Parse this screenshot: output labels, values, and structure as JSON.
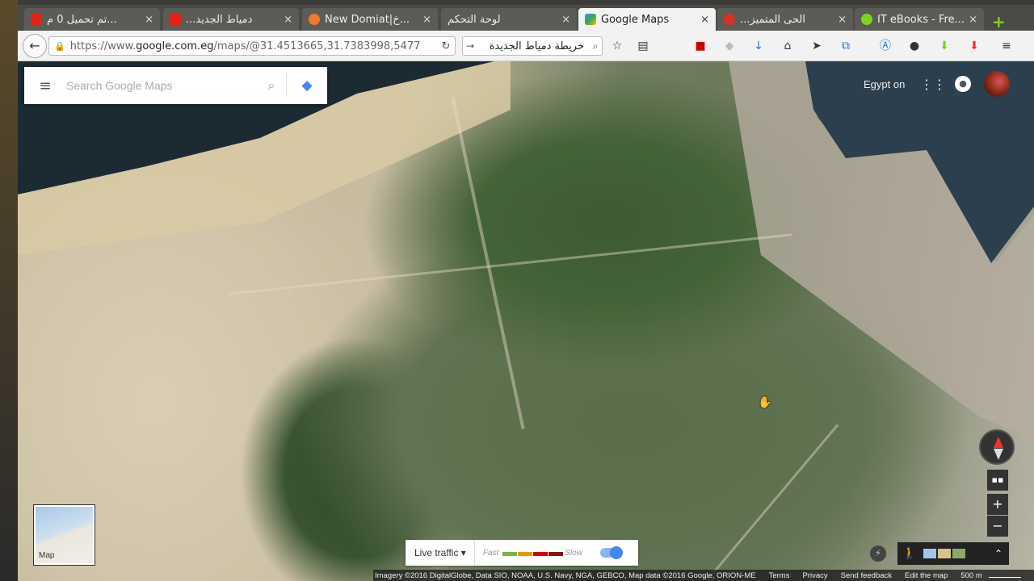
{
  "browser": {
    "tabs": [
      {
        "title": "تم تحميل 0 م...",
        "favicon_color": "#e62117"
      },
      {
        "title": "...دمياط الجديد",
        "favicon_color": "#e62117"
      },
      {
        "title": "New Domiat|خ...",
        "favicon_color": "#f07a2a"
      },
      {
        "title": "لوحة التحكم",
        "favicon_color": "#cccccc"
      },
      {
        "title": "Google Maps",
        "favicon_color": "#34a853"
      },
      {
        "title": "...الحى المتميز",
        "favicon_color": "#d93025"
      },
      {
        "title": "IT eBooks - Fre...",
        "favicon_color": "#7ed321"
      }
    ],
    "new_tab_glyph": "+",
    "close_glyph": "×",
    "url_prefix": "https://www.",
    "url_domain": "google.com.eg",
    "url_rest": "/maps/@31.4513665,31.7383998,5477",
    "search_query": "خريطة دمياط الجديدة"
  },
  "maps": {
    "search_placeholder": "Search Google Maps",
    "region_label": "Egypt on",
    "minimap_label": "Map",
    "traffic": {
      "label": "Live traffic",
      "fast": "Fast",
      "slow": "Slow",
      "colors": [
        "#7cb342",
        "#f09300",
        "#d50000",
        "#8e1010"
      ]
    },
    "footer": {
      "imagery": "Imagery ©2016 DigitalGlobe, Data SIO, NOAA, U.S. Navy, NGA, GEBCO, Map data ©2016 Google, ORION-ME",
      "terms": "Terms",
      "privacy": "Privacy",
      "feedback": "Send feedback",
      "edit": "Edit the map",
      "scale": "500 m"
    }
  },
  "icons": {
    "back": "back-arrow-icon",
    "lock": "lock-icon",
    "reload": "reload-icon",
    "menu": "hamburger-menu-icon",
    "search": "search-icon",
    "directions": "directions-icon",
    "apps": "apps-grid-icon",
    "notifications": "notification-bell-icon",
    "compass": "compass-icon",
    "zoom_in": "zoom-in-icon",
    "zoom_out": "zoom-out-icon",
    "pegman": "pegman-icon"
  }
}
